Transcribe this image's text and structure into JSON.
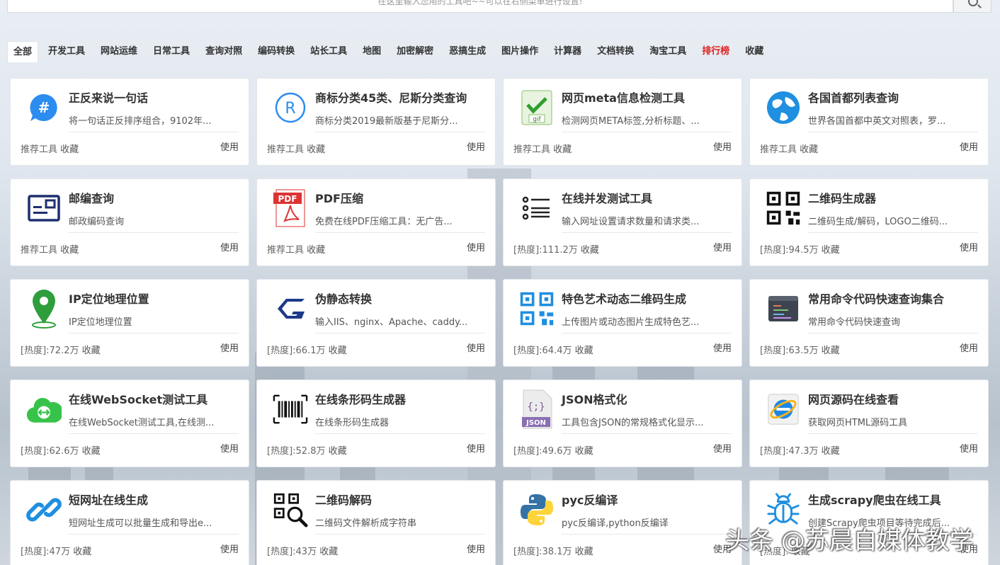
{
  "search": {
    "placeholder": "在这里输入您用的工具吧~~可以在右侧菜单进行设置!"
  },
  "tabs": [
    {
      "label": "全部",
      "active": true
    },
    {
      "label": "开发工具"
    },
    {
      "label": "网站运维"
    },
    {
      "label": "日常工具"
    },
    {
      "label": "查询对照"
    },
    {
      "label": "编码转换"
    },
    {
      "label": "站长工具"
    },
    {
      "label": "地图"
    },
    {
      "label": "加密解密"
    },
    {
      "label": "恶搞生成"
    },
    {
      "label": "图片操作"
    },
    {
      "label": "计算器"
    },
    {
      "label": "文档转换"
    },
    {
      "label": "淘宝工具"
    },
    {
      "label": "排行榜",
      "hot": true
    },
    {
      "label": "收藏"
    }
  ],
  "cards": [
    {
      "title": "正反来说一句话",
      "desc": "将一句话正反排序组合，9102年...",
      "meta": "推荐工具",
      "fav": "收藏",
      "use": "使用",
      "icon": "hash-bubble-icon"
    },
    {
      "title": "商标分类45类、尼斯分类查询",
      "desc": "商标分类2019最新版基于尼斯分...",
      "meta": "推荐工具",
      "fav": "收藏",
      "use": "使用",
      "icon": "registered-icon"
    },
    {
      "title": "网页meta信息检测工具",
      "desc": "检测网页META标签,分析标题、...",
      "meta": "推荐工具",
      "fav": "收藏",
      "use": "使用",
      "icon": "gif-check-icon"
    },
    {
      "title": "各国首都列表查询",
      "desc": "世界各国首都中英文对照表，罗...",
      "meta": "推荐工具",
      "fav": "收藏",
      "use": "使用",
      "icon": "globe-icon"
    },
    {
      "title": "邮编查询",
      "desc": "邮政编码查询",
      "meta": "推荐工具",
      "fav": "收藏",
      "use": "使用",
      "icon": "postcard-icon"
    },
    {
      "title": "PDF压缩",
      "desc": "免费在线PDF压缩工具：无广告...",
      "meta": "推荐工具",
      "fav": "收藏",
      "use": "使用",
      "icon": "pdf-icon"
    },
    {
      "title": "在线并发测试工具",
      "desc": "输入网址设置请求数量和请求类...",
      "meta": "[热度]:111.2万",
      "fav": "收藏",
      "use": "使用",
      "icon": "list-icon"
    },
    {
      "title": "二维码生成器",
      "desc": "二维码生成/解码，LOGO二维码...",
      "meta": "[热度]:94.5万",
      "fav": "收藏",
      "use": "使用",
      "icon": "qrcode-icon"
    },
    {
      "title": "IP定位地理位置",
      "desc": "IP定位地理位置",
      "meta": "[热度]:72.2万",
      "fav": "收藏",
      "use": "使用",
      "icon": "map-pin-icon"
    },
    {
      "title": "伪静态转换",
      "desc": "输入IIS、nginx、Apache、caddy...",
      "meta": "[热度]:66.1万",
      "fav": "收藏",
      "use": "使用",
      "icon": "g-logo-icon"
    },
    {
      "title": "特色艺术动态二维码生成",
      "desc": "上传图片或动态图片生成特色艺...",
      "meta": "[热度]:64.4万",
      "fav": "收藏",
      "use": "使用",
      "icon": "art-qrcode-icon"
    },
    {
      "title": "常用命令代码快速查询集合",
      "desc": "常用命令代码快速查询",
      "meta": "[热度]:63.5万",
      "fav": "收藏",
      "use": "使用",
      "icon": "code-window-icon"
    },
    {
      "title": "在线WebSocket测试工具",
      "desc": "在线WebSocket测试工具,在线测...",
      "meta": "[热度]:62.6万",
      "fav": "收藏",
      "use": "使用",
      "icon": "cloud-plug-icon"
    },
    {
      "title": "在线条形码生成器",
      "desc": "在线条形码生成器",
      "meta": "[热度]:52.8万",
      "fav": "收藏",
      "use": "使用",
      "icon": "barcode-icon"
    },
    {
      "title": "JSON格式化",
      "desc": "工具包含JSON的常规格式化显示...",
      "meta": "[热度]:49.6万",
      "fav": "收藏",
      "use": "使用",
      "icon": "json-file-icon"
    },
    {
      "title": "网页源码在线查看",
      "desc": "获取网页HTML源码工具",
      "meta": "[热度]:47.3万",
      "fav": "收藏",
      "use": "使用",
      "icon": "ie-browser-icon"
    },
    {
      "title": "短网址在线生成",
      "desc": "短网址生成可以批量生成和导出e...",
      "meta": "[热度]:47万",
      "fav": "收藏",
      "use": "使用",
      "icon": "link-icon"
    },
    {
      "title": "二维码解码",
      "desc": "二维码文件解析成字符串",
      "meta": "[热度]:43万",
      "fav": "收藏",
      "use": "使用",
      "icon": "qrcode-search-icon"
    },
    {
      "title": "pyc反编译",
      "desc": "pyc反编译,python反编译",
      "meta": "[热度]:38.1万",
      "fav": "收藏",
      "use": "使用",
      "icon": "python-icon"
    },
    {
      "title": "生成scrapy爬虫在线工具",
      "desc": "创建Scrapy爬虫项目等待完成后...",
      "meta": "[热度]:",
      "fav": "收藏",
      "use": "使用",
      "icon": "bug-icon"
    }
  ],
  "watermark": "头条 @苏晨自媒体教学"
}
